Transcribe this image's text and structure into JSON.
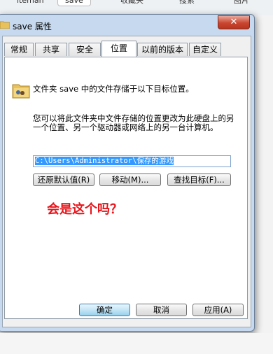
{
  "top_tabs": [
    "iteman",
    "save",
    "收藏夹",
    "搜索",
    "图片"
  ],
  "window": {
    "title": "save 属性",
    "close_glyph": "✕"
  },
  "tabs": [
    "常规",
    "共享",
    "安全",
    "位置",
    "以前的版本",
    "自定义"
  ],
  "active_tab": "位置",
  "location": {
    "description": "文件夹 save 中的文件存储于以下目标位置。",
    "explanation": "您可以将此文件夹中文件存储的位置更改为此硬盘上的另一个位置、另一个驱动器或网络上的另一台计算机。",
    "path_value": "C:\\Users\\Administrator\\保存的游戏"
  },
  "buttons": {
    "restore_default": "还原默认值(R)",
    "move": "移动(M)...",
    "find_target": "查找目标(F)..."
  },
  "annotation_text": "会是这个吗？",
  "footer": {
    "ok": "确定",
    "cancel": "取消",
    "apply": "应用(A)"
  },
  "icons": [
    "folder-icon",
    "close-icon"
  ]
}
